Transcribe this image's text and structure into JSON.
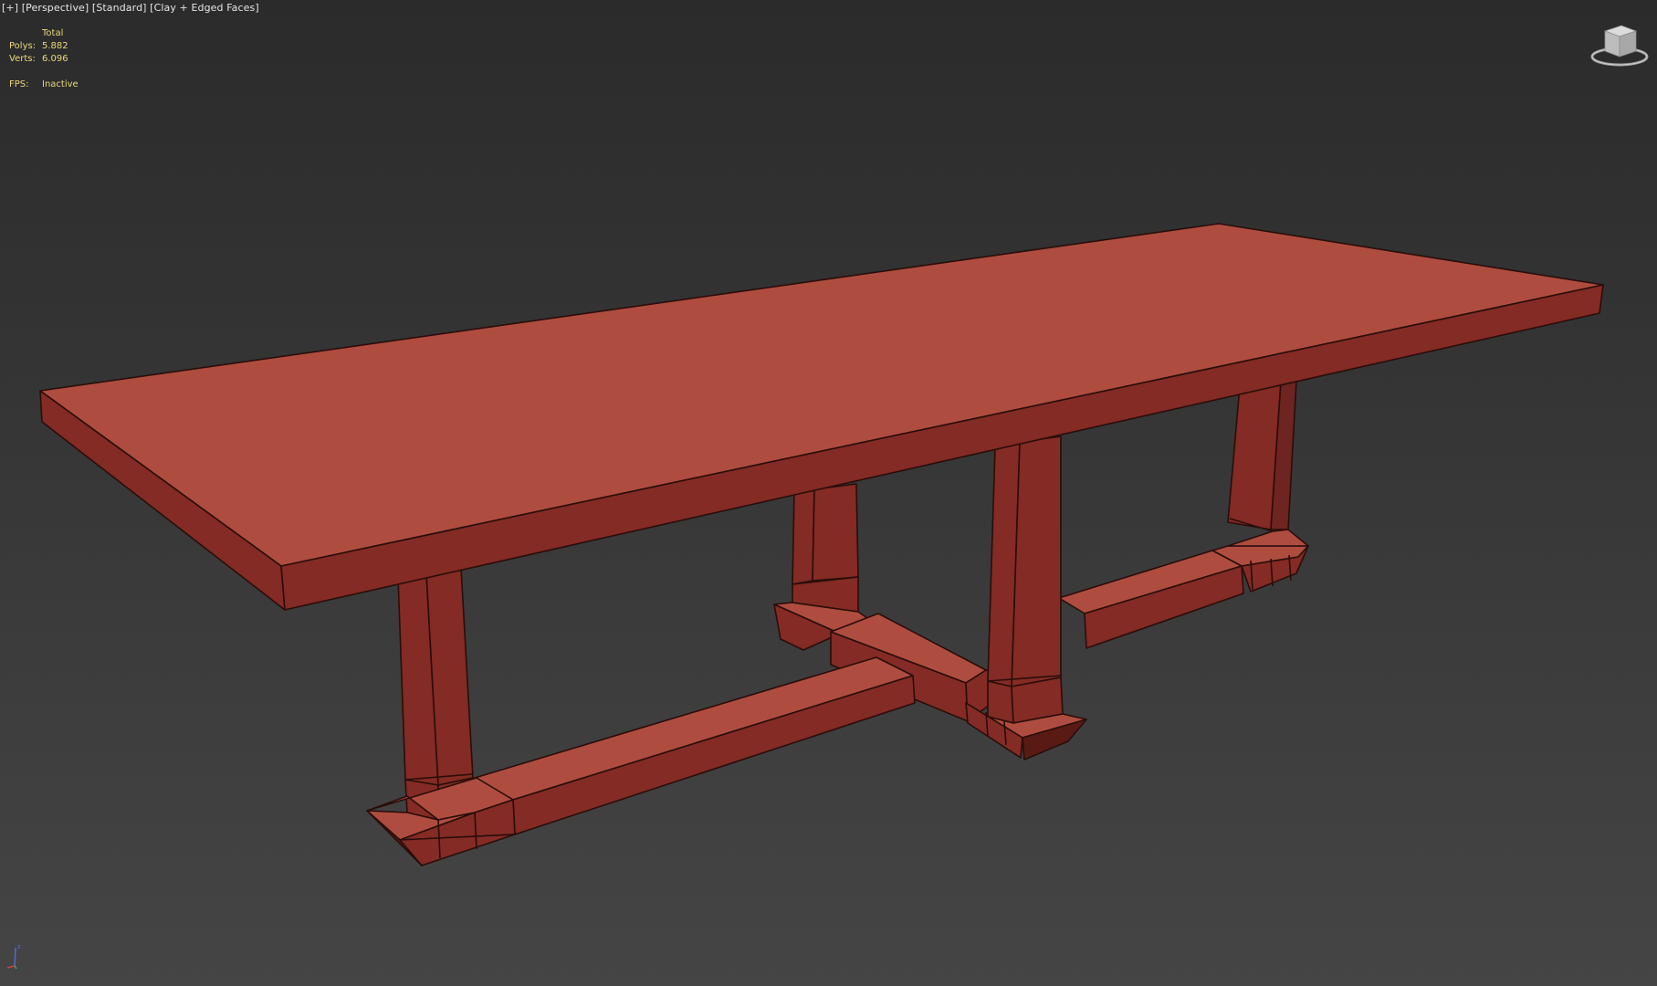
{
  "viewport": {
    "label_plus": "[+]",
    "label_view": "[Perspective]",
    "label_shading": "[Standard]",
    "label_display": "[Clay + Edged Faces]"
  },
  "stats": {
    "header": "Total",
    "polys_key": "Polys:",
    "polys_value": "5.882",
    "verts_key": "Verts:",
    "verts_value": "6.096",
    "fps_key": "FPS:",
    "fps_value": "Inactive"
  },
  "colors": {
    "text_label": "#e6e6e6",
    "text_stats": "#e8d97a",
    "clay_top": "#ae4d3f",
    "clay_side": "#832b24",
    "clay_dark": "#5a1a14",
    "edge": "#2a0d0a"
  },
  "icons": {
    "viewcube": "viewcube-icon",
    "axis": "axis-tripod-icon"
  }
}
